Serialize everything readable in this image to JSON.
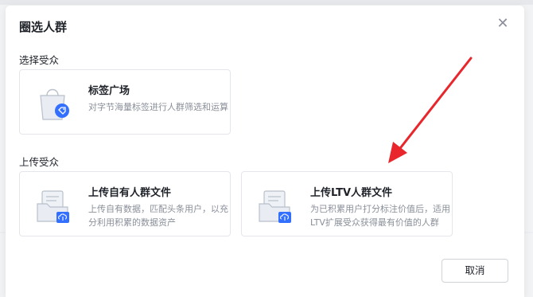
{
  "dialog": {
    "title": "圈选人群",
    "close_icon": "close-icon"
  },
  "select_section": {
    "label": "选择受众",
    "cards": [
      {
        "title": "标签广场",
        "description": "对字节海量标签进行人群筛选和运算",
        "icon": "shopping-bag-tag-icon"
      }
    ]
  },
  "upload_section": {
    "label": "上传受众",
    "cards": [
      {
        "title": "上传自有人群文件",
        "description": "上传自有数据，匹配头条用户，以充分利用积累的数据资产",
        "icon": "file-upload-icon"
      },
      {
        "title": "上传LTV人群文件",
        "description": "为已积累用户打分标注价值后，适用LTV扩展受众获得最有价值的人群",
        "icon": "file-upload-icon"
      }
    ]
  },
  "footer": {
    "cancel_label": "取消"
  },
  "colors": {
    "accent": "#3370ff",
    "annotation_arrow": "#e8262b",
    "border": "#e5e6eb"
  },
  "annotation": "red-arrow-pointing-to-ltv-card"
}
